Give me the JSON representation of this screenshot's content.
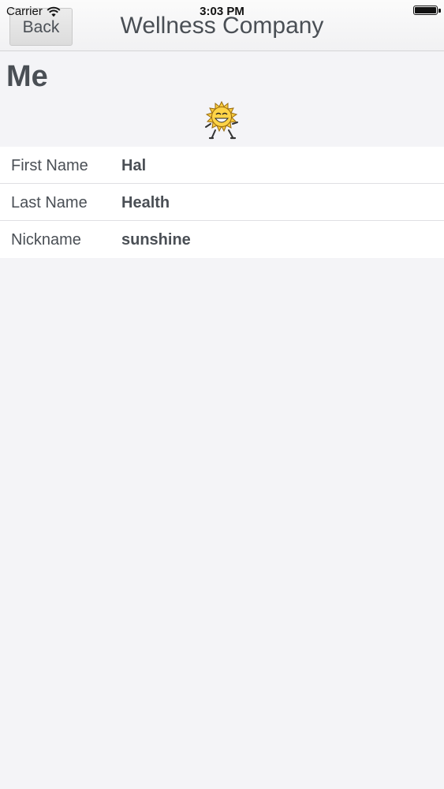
{
  "status_bar": {
    "carrier": "Carrier",
    "time": "3:03 PM",
    "wifi_icon": "wifi-icon",
    "battery_icon": "battery-icon",
    "battery_level": 1.0
  },
  "navbar": {
    "back_label": "Back",
    "title": "Wellness Company"
  },
  "page": {
    "title": "Me",
    "avatar_icon": "sun-mascot-avatar"
  },
  "profile": {
    "rows": [
      {
        "label": "First Name",
        "value": "Hal"
      },
      {
        "label": "Last Name",
        "value": "Health"
      },
      {
        "label": "Nickname",
        "value": "sunshine"
      }
    ]
  },
  "colors": {
    "background": "#f4f4f7",
    "text": "#4a4f55",
    "row_background": "#ffffff",
    "sun_yellow": "#f6c93b"
  }
}
